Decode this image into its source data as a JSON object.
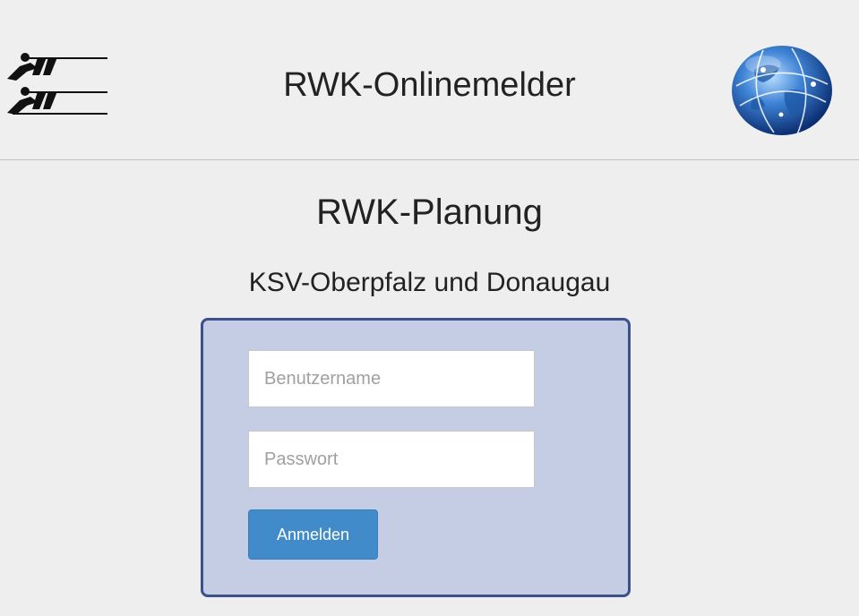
{
  "header": {
    "app_title": "RWK-Onlinemelder"
  },
  "main": {
    "title": "RWK-Planung",
    "subtitle": "KSV-Oberpfalz und Donaugau"
  },
  "login": {
    "username_placeholder": "Benutzername",
    "username_value": "",
    "password_placeholder": "Passwort",
    "password_value": "",
    "submit_label": "Anmelden"
  },
  "colors": {
    "background": "#eeeeee",
    "panel_background": "#c5cde5",
    "panel_border": "#3d4f8c",
    "button": "#428bca"
  },
  "icons": {
    "left_logo": "rowing-logo-icon",
    "right_logo": "globe-icon"
  }
}
